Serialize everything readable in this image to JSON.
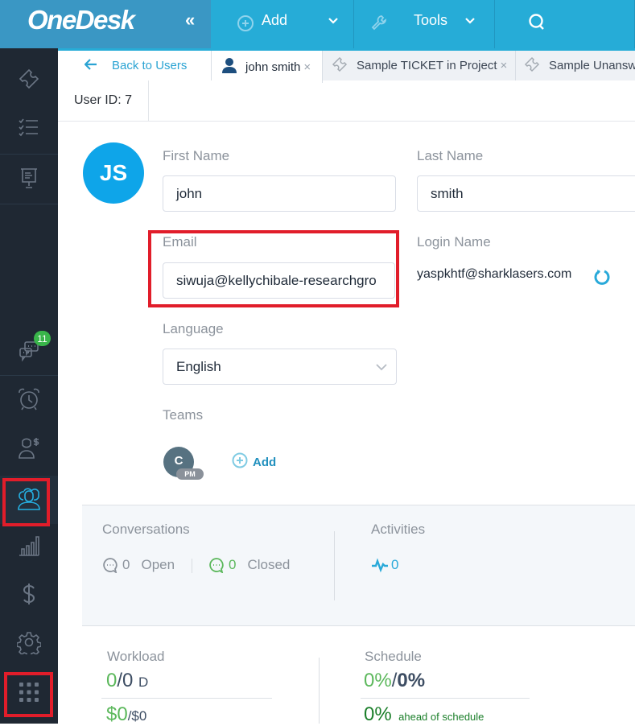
{
  "topbar": {
    "logo": "OneDesk",
    "collapse_icon": "double-chevron-left",
    "add_label": "Add",
    "tools_label": "Tools",
    "search_icon": "search"
  },
  "sidebar": {
    "items": [
      {
        "name": "tickets",
        "icon": "ticket-icon"
      },
      {
        "name": "tasks",
        "icon": "checklist-icon"
      },
      {
        "name": "projects",
        "icon": "presentation-board-icon"
      },
      {
        "name": "messages",
        "icon": "chat-bubbles-icon",
        "badge": "11"
      },
      {
        "name": "timesheets",
        "icon": "alarm-clock-icon"
      },
      {
        "name": "customers",
        "icon": "user-dollar-icon"
      },
      {
        "name": "users",
        "icon": "users-icon",
        "active": true
      },
      {
        "name": "analytics",
        "icon": "bar-chart-icon"
      },
      {
        "name": "invoices",
        "icon": "dollar-icon"
      },
      {
        "name": "administration",
        "icon": "gear-icon"
      },
      {
        "name": "apps",
        "icon": "grid-icon"
      }
    ]
  },
  "tabs": {
    "back_label": "Back to Users",
    "items": [
      {
        "label": "john smith",
        "icon": "user-icon",
        "active": true
      },
      {
        "label": "Sample TICKET in Project",
        "icon": "ticket-icon"
      },
      {
        "label": "Sample Unansw",
        "icon": "ticket-icon"
      }
    ],
    "close_glyph": "×"
  },
  "user": {
    "id_label": "User ID: 7",
    "initials": "JS",
    "first_name_label": "First Name",
    "first_name": "john",
    "last_name_label": "Last Name",
    "last_name": "smith",
    "email_label": "Email",
    "email": "siwuja@kellychibale-researchgro",
    "login_label": "Login Name",
    "login": "yaspkhtf@sharklasers.com",
    "language_label": "Language",
    "language": "English",
    "teams_label": "Teams",
    "team_initial": "C",
    "team_role": "PM",
    "add_team_label": "Add"
  },
  "stats": {
    "conversations_title": "Conversations",
    "open_count": "0",
    "open_label": "Open",
    "closed_count": "0",
    "closed_label": "Closed",
    "activities_title": "Activities",
    "activities_count": "0"
  },
  "workload": {
    "title": "Workload",
    "done": "0",
    "total": "/0",
    "unit": "D",
    "cost_done": "$0",
    "cost_total": "/$0"
  },
  "schedule": {
    "title": "Schedule",
    "progress": "0%",
    "planned": "0%",
    "delta": "0%",
    "delta_label": "ahead of schedule"
  },
  "colors": {
    "brand": "#26acd7",
    "sidebar": "#1f2833",
    "accent_green": "#5cb85c",
    "highlight_red": "#e11d2a"
  }
}
